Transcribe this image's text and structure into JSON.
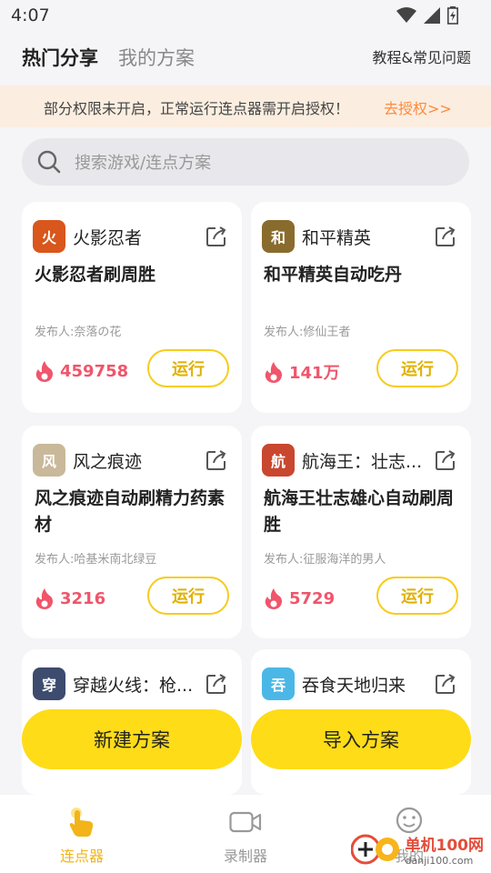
{
  "status_bar": {
    "time": "4:07"
  },
  "header": {
    "tabs": [
      {
        "label": "热门分享"
      },
      {
        "label": "我的方案"
      }
    ],
    "help_link": "教程&常见问题"
  },
  "notice": {
    "text": "部分权限未开启，正常运行连点器需开启授权！",
    "link": "去授权>>"
  },
  "search": {
    "placeholder": "搜索游戏/连点方案"
  },
  "cards": [
    {
      "game": "火影忍者",
      "title": "火影忍者刷周胜",
      "publisher": "发布人:奈落の花",
      "count": "459758",
      "run_label": "运行",
      "icon_color": "#d9561c",
      "icon_glyph": "火"
    },
    {
      "game": "和平精英",
      "title": "和平精英自动吃丹",
      "publisher": "发布人:修仙王者",
      "count": "141万",
      "run_label": "运行",
      "icon_color": "#8a6b2e",
      "icon_glyph": "和"
    },
    {
      "game": "风之痕迹",
      "title": "风之痕迹自动刷精力药素材",
      "publisher": "发布人:哈基米南北绿豆",
      "count": "3216",
      "run_label": "运行",
      "icon_color": "#c9b89a",
      "icon_glyph": "风"
    },
    {
      "game": "航海王：壮志...",
      "title": "航海王壮志雄心自动刷周胜",
      "publisher": "发布人:征服海洋的男人",
      "count": "5729",
      "run_label": "运行",
      "icon_color": "#c9462f",
      "icon_glyph": "航"
    },
    {
      "game": "穿越火线：枪...",
      "icon_color": "#3c4b6e",
      "icon_glyph": "穿"
    },
    {
      "game": "吞食天地归来",
      "icon_color": "#4bb7e6",
      "icon_glyph": "吞"
    }
  ],
  "actions": {
    "new_plan": "新建方案",
    "import_plan": "导入方案"
  },
  "bottom_nav": [
    {
      "label": "连点器"
    },
    {
      "label": "录制器"
    },
    {
      "label": "我的"
    }
  ],
  "watermark": {
    "title": "单机100网",
    "url": "danji100.com"
  },
  "colors": {
    "accent": "#fedc18",
    "hot": "#f0556b",
    "active_nav": "#f2b418",
    "notice_link": "#ff8a3d"
  }
}
